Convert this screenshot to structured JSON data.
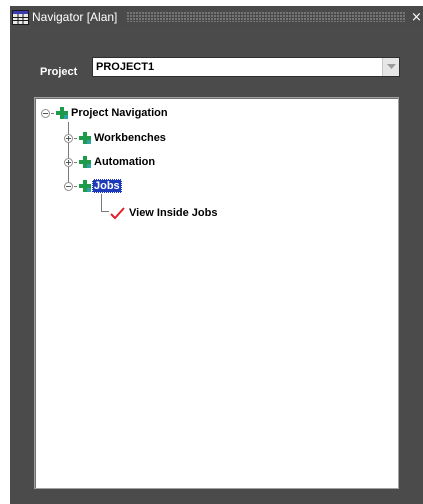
{
  "window": {
    "title": "Navigator [Alan]",
    "close_glyph": "×",
    "title_icon": "grid-app-icon"
  },
  "project": {
    "label": "Project",
    "value": "PROJECT1"
  },
  "tree": {
    "root": {
      "label": "Project Navigation",
      "expanded": true,
      "icon": "green-cross-node-icon"
    },
    "items": [
      {
        "label": "Workbenches",
        "expanded": false,
        "icon": "green-cross-node-icon"
      },
      {
        "label": "Automation",
        "expanded": false,
        "icon": "green-cross-node-icon"
      },
      {
        "label": "Jobs",
        "expanded": true,
        "selected": true,
        "icon": "green-cross-node-icon"
      }
    ],
    "leaf": {
      "label": "View Inside Jobs",
      "icon": "red-checkmark-icon"
    }
  },
  "colors": {
    "panel": "#4b4b4b",
    "selection": "#1b39b8",
    "check": "#e0202a",
    "node_green": "#1f9a4a",
    "node_teal": "#2ea2a6"
  }
}
